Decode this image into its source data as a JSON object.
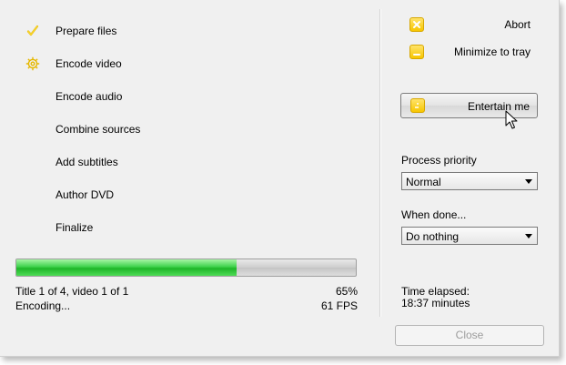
{
  "steps": [
    {
      "label": "Prepare files",
      "icon": "checkmark-icon"
    },
    {
      "label": "Encode video",
      "icon": "gear-icon"
    },
    {
      "label": "Encode audio",
      "icon": ""
    },
    {
      "label": "Combine sources",
      "icon": ""
    },
    {
      "label": "Add subtitles",
      "icon": ""
    },
    {
      "label": "Author DVD",
      "icon": ""
    },
    {
      "label": "Finalize",
      "icon": ""
    }
  ],
  "progress": {
    "value": 0.65,
    "title_info": "Title 1 of 4, video 1 of 1",
    "percent": "65%",
    "status": "Encoding...",
    "fps": "61 FPS"
  },
  "actions": {
    "abort_label": "Abort",
    "minimize_label": "Minimize to tray",
    "entertain_label": "Entertain me"
  },
  "priority": {
    "label": "Process priority",
    "selected": "Normal"
  },
  "when_done": {
    "label": "When done...",
    "selected": "Do nothing"
  },
  "time": {
    "label": "Time elapsed:",
    "value": "18:37 minutes"
  },
  "close_label": "Close",
  "colors": {
    "accent_yellow": "#f7c600",
    "progress_green": "#1fb528"
  }
}
